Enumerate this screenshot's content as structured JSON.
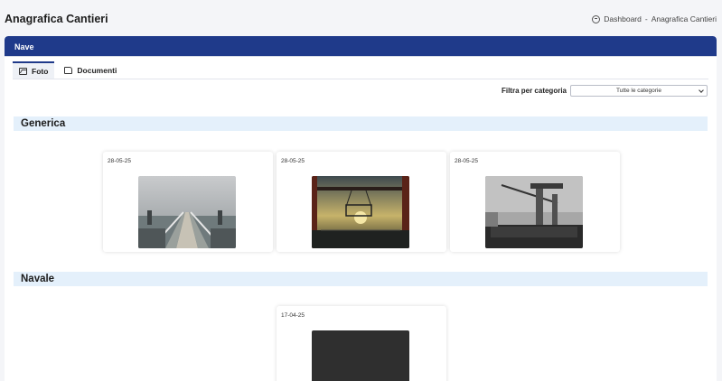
{
  "header": {
    "title": "Anagrafica Cantieri",
    "breadcrumb": {
      "home": "Dashboard",
      "separator": "-",
      "current": "Anagrafica Cantieri"
    }
  },
  "card": {
    "title": "Nave"
  },
  "tabs": [
    {
      "label": "Foto",
      "icon": "image-icon",
      "active": true
    },
    {
      "label": "Documenti",
      "icon": "folder-icon",
      "active": false
    }
  ],
  "filter": {
    "label": "Filtra per categoria",
    "selected": "Tutte le categorie"
  },
  "sections": [
    {
      "title": "Generica",
      "photos": [
        {
          "date": "28-05-25",
          "subject": "pier"
        },
        {
          "date": "28-05-25",
          "subject": "crane-sunset"
        },
        {
          "date": "28-05-25",
          "subject": "ship-crane"
        }
      ]
    },
    {
      "title": "Navale",
      "photos": [
        {
          "date": "17-04-25",
          "subject": "dark"
        }
      ]
    }
  ],
  "colors": {
    "header_bg": "#1f3a8a",
    "section_bg": "#e4f0fb",
    "page_bg": "#f4f5f8"
  }
}
